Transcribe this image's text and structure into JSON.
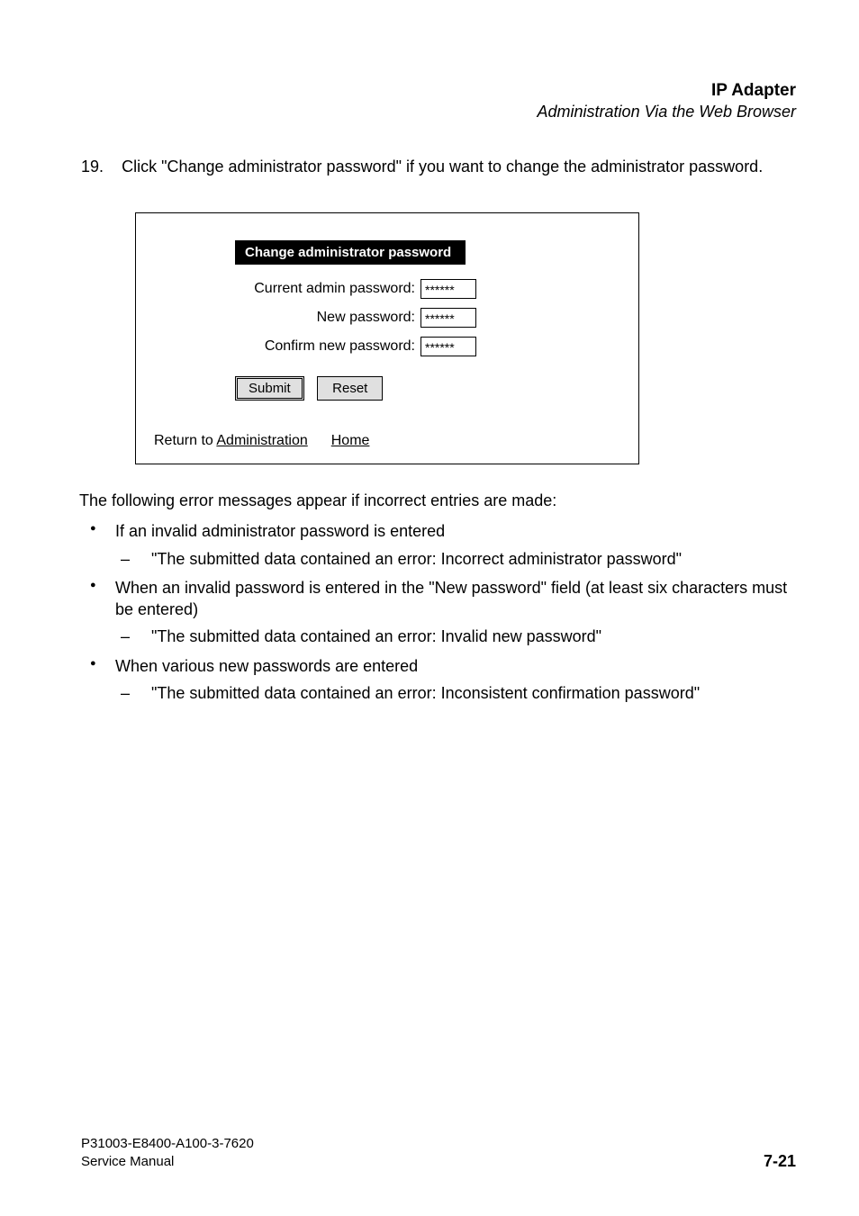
{
  "header": {
    "title": "IP Adapter",
    "subtitle": "Administration Via the Web Browser"
  },
  "step": {
    "number": "19.",
    "text": "Click \"Change administrator password\" if you want to change the administrator password."
  },
  "form": {
    "title": "Change administrator password",
    "currentLabel": "Current admin password:",
    "currentValue": "******",
    "newLabel": "New password:",
    "newValue": "******",
    "confirmLabel": "Confirm new password:",
    "confirmValue": "******",
    "submitLabel": "Submit",
    "resetLabel": "Reset",
    "returnPrefix": "Return to ",
    "returnAdminLink": "Administration",
    "returnHomeLink": "Home"
  },
  "errors": {
    "intro": "The following error messages appear if incorrect entries are made:",
    "b1": "If an invalid administrator password is entered",
    "d1": "\"The submitted data contained an error: Incorrect administrator password\"",
    "b2": "When an invalid password is entered in the \"New password\" field (at least six characters must be entered)",
    "d2": "\"The submitted data contained an error: Invalid new password\"",
    "b3": "When various new passwords are entered",
    "d3": "\"The submitted data contained an error: Inconsistent confirmation password\""
  },
  "footer": {
    "line1": "P31003-E8400-A100-3-7620",
    "line2": "Service Manual",
    "pageNum": "7-21"
  }
}
